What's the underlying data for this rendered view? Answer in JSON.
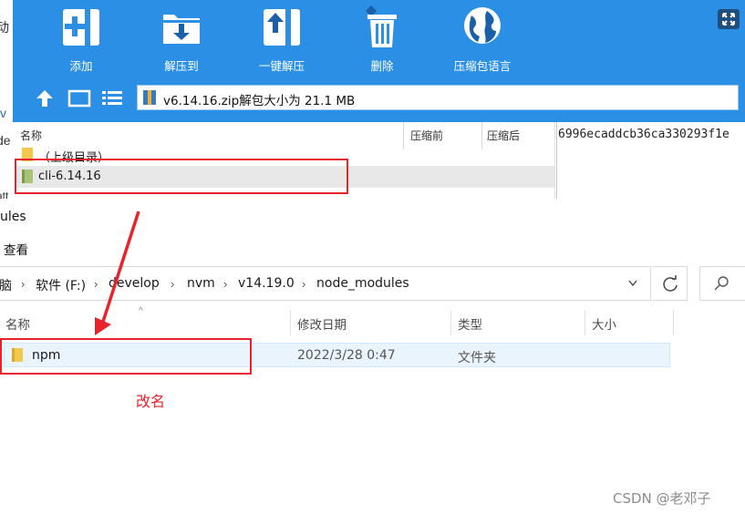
{
  "zip_tool": {
    "toolbar": [
      {
        "label": "添加",
        "icon": "add-icon"
      },
      {
        "label": "解压到",
        "icon": "extract-to-icon"
      },
      {
        "label": "一键解压",
        "icon": "quick-extract-icon"
      },
      {
        "label": "删除",
        "icon": "delete-icon"
      },
      {
        "label": "压缩包语言",
        "icon": "language-globe-icon"
      }
    ],
    "path": "v6.14.16.zip解包大小为 21.1 MB",
    "columns": [
      "名称",
      "压缩前",
      "压缩后"
    ],
    "hash_text": "6996ecaddcb36ca330293f1e",
    "rows": [
      {
        "name": "（上级目录）",
        "selected": false
      },
      {
        "name": "cli-6.14.16",
        "selected": true
      }
    ]
  },
  "explorer": {
    "title_fragment": "ules",
    "menu_view": "查看",
    "breadcrumbs": [
      "脑",
      "软件 (F:)",
      "develop",
      "nvm",
      "v14.19.0",
      "node_modules"
    ],
    "columns": [
      "名称",
      "修改日期",
      "类型",
      "大小"
    ],
    "rows": [
      {
        "name": "npm",
        "modified": "2022/3/28 0:47",
        "type": "文件夹",
        "size": ""
      }
    ]
  },
  "annotation": {
    "label": "改名",
    "color": "#e8232b"
  },
  "background_fragments": [
    "动",
    "v",
    "de",
    "att"
  ],
  "watermark": "CSDN @老邓子",
  "colors": {
    "zip_blue": "#2b8fe6",
    "annotation_red": "#e8232b",
    "selection_blue": "#eaf4fd"
  }
}
